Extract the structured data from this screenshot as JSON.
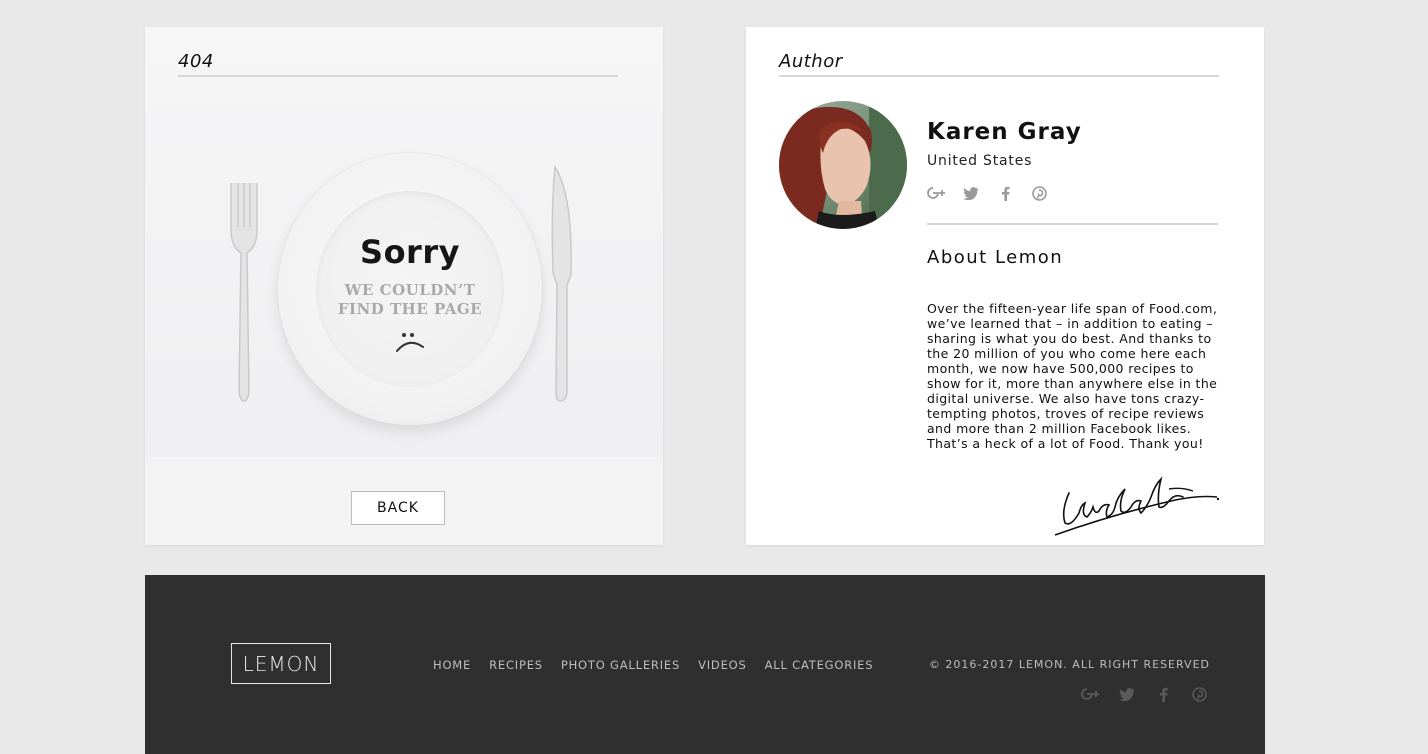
{
  "error_card": {
    "heading": "404",
    "title": "Sorry",
    "subtitle_line1": "WE COULDN’T",
    "subtitle_line2": "FIND THE PAGE",
    "back_label": "BACK"
  },
  "author_card": {
    "heading": "Author",
    "name": "Karen Gray",
    "country": "United States",
    "social_icons": [
      "google-plus-icon",
      "twitter-icon",
      "facebook-icon",
      "pinterest-icon"
    ],
    "about_title": "About Lemon",
    "about_text": "Over the fifteen-year life span of Food.com, we’ve learned that – in addition to eating – sharing is what you do best. And thanks to the 20 million of you who come here each month, we now have 500,000 recipes to show for it, more than anywhere else in the digital universe. We also have tons crazy-tempting photos, troves of recipe reviews and more than 2 million Facebook likes. That’s a heck of a lot of Food. Thank you!"
  },
  "footer": {
    "logo": "LEMON",
    "nav": [
      "HOME",
      "RECIPES",
      "PHOTO GALLERIES",
      "VIDEOS",
      "ALL CATEGORIES"
    ],
    "copyright": "© 2016-2017 LEMON. ALL RIGHT RESERVED",
    "social_icons": [
      "google-plus-icon",
      "twitter-icon",
      "facebook-icon",
      "pinterest-icon"
    ]
  },
  "colors": {
    "page_bg": "#e9e9e9",
    "footer_bg": "#2f2f2f",
    "footer_text": "#bdbdbd",
    "icon_gray": "#9a9a9a",
    "subtitle_gray": "#a9a9a9"
  }
}
